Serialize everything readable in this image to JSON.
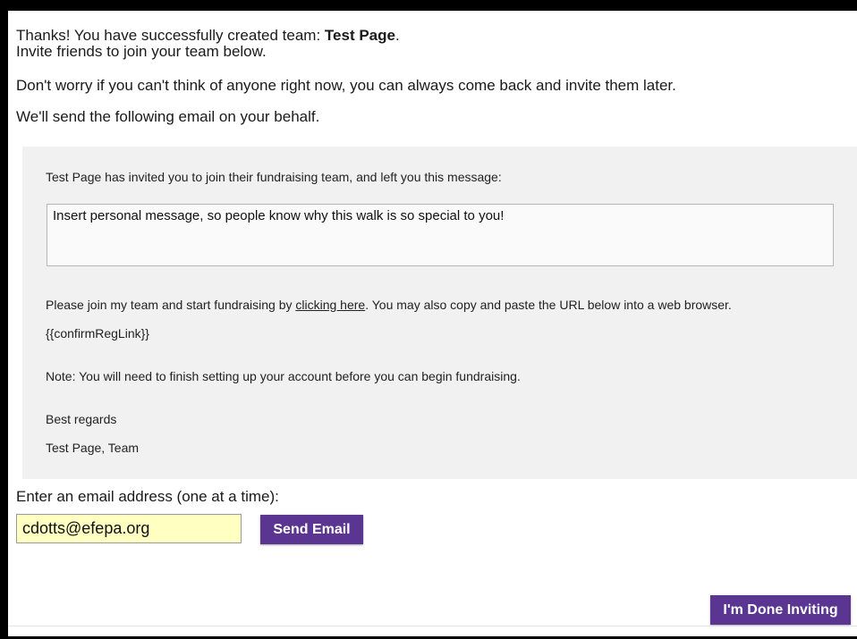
{
  "intro": {
    "thanks_prefix": "Thanks! You have successfully created team: ",
    "team_name": "Test Page",
    "thanks_suffix": ".",
    "invite_line": "Invite friends to join your team below.",
    "worry_line": "Don't worry if you can't think of anyone right now, you can always come back and invite them later.",
    "behalf_line": "We'll send the following email on your behalf."
  },
  "email_preview": {
    "invited_text": "Test Page has invited you to join their fundraising team, and left you this message:",
    "personal_message": "Insert personal message, so people know why this walk is so special to you!",
    "join_prefix": "Please join my team and start fundraising by ",
    "join_link": "clicking here",
    "join_suffix": ". You may also copy and paste the URL below into a web browser.",
    "confirm_link_token": "{{confirmRegLink}}",
    "note": "Note: You will need to finish setting up your account before you can begin fundraising.",
    "regards": "Best regards",
    "signoff": "Test Page, Team"
  },
  "invite_form": {
    "label": "Enter an email address (one at a time):",
    "email_value": "cdotts@efepa.org",
    "send_label": "Send Email",
    "done_label": "I'm Done Inviting"
  },
  "colors": {
    "button_bg": "#5b3592",
    "input_bg": "#ffffc2",
    "panel_bg": "#f1f1f1"
  }
}
